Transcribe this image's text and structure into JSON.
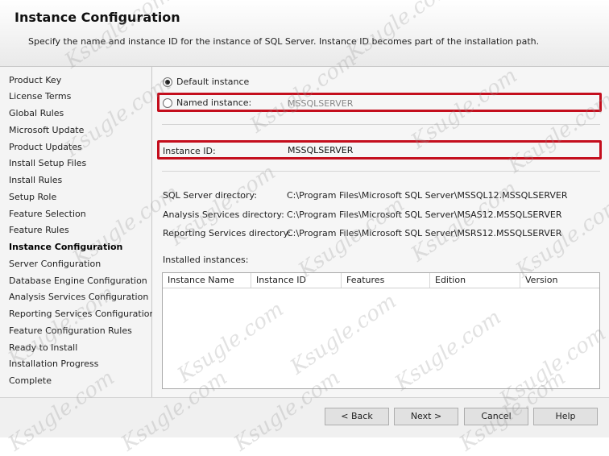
{
  "header": {
    "title": "Instance Configuration",
    "description": "Specify the name and instance ID for the instance of SQL Server. Instance ID becomes part of the installation path."
  },
  "sidebar": {
    "steps": [
      {
        "label": "Product Key"
      },
      {
        "label": "License Terms"
      },
      {
        "label": "Global Rules"
      },
      {
        "label": "Microsoft Update"
      },
      {
        "label": "Product Updates"
      },
      {
        "label": "Install Setup Files"
      },
      {
        "label": "Install Rules"
      },
      {
        "label": "Setup Role"
      },
      {
        "label": "Feature Selection"
      },
      {
        "label": "Feature Rules"
      },
      {
        "label": "Instance Configuration",
        "active": true
      },
      {
        "label": "Server Configuration"
      },
      {
        "label": "Database Engine Configuration"
      },
      {
        "label": "Analysis Services Configuration"
      },
      {
        "label": "Reporting Services Configuration"
      },
      {
        "label": "Feature Configuration Rules"
      },
      {
        "label": "Ready to Install"
      },
      {
        "label": "Installation Progress"
      },
      {
        "label": "Complete"
      }
    ]
  },
  "main": {
    "default_instance_label": "Default instance",
    "default_instance_selected": true,
    "named_instance_label": "Named instance:",
    "named_instance_value": "MSSQLSERVER",
    "instance_id_label": "Instance ID:",
    "instance_id_value": "MSSQLSERVER",
    "directories": [
      {
        "label": "SQL Server directory:",
        "value": "C:\\Program Files\\Microsoft SQL Server\\MSSQL12.MSSQLSERVER"
      },
      {
        "label": "Analysis Services directory:",
        "value": "C:\\Program Files\\Microsoft SQL Server\\MSAS12.MSSQLSERVER"
      },
      {
        "label": "Reporting Services directory:",
        "value": "C:\\Program Files\\Microsoft SQL Server\\MSRS12.MSSQLSERVER"
      }
    ],
    "installed_instances_label": "Installed instances:",
    "columns": [
      "Instance Name",
      "Instance ID",
      "Features",
      "Edition",
      "Version"
    ]
  },
  "footer": {
    "back": "< Back",
    "next": "Next >",
    "cancel": "Cancel",
    "help": "Help"
  },
  "colors": {
    "highlight_border": "#c40e1d",
    "watermark": "#969696"
  },
  "watermark_text": "Ksugle.com"
}
